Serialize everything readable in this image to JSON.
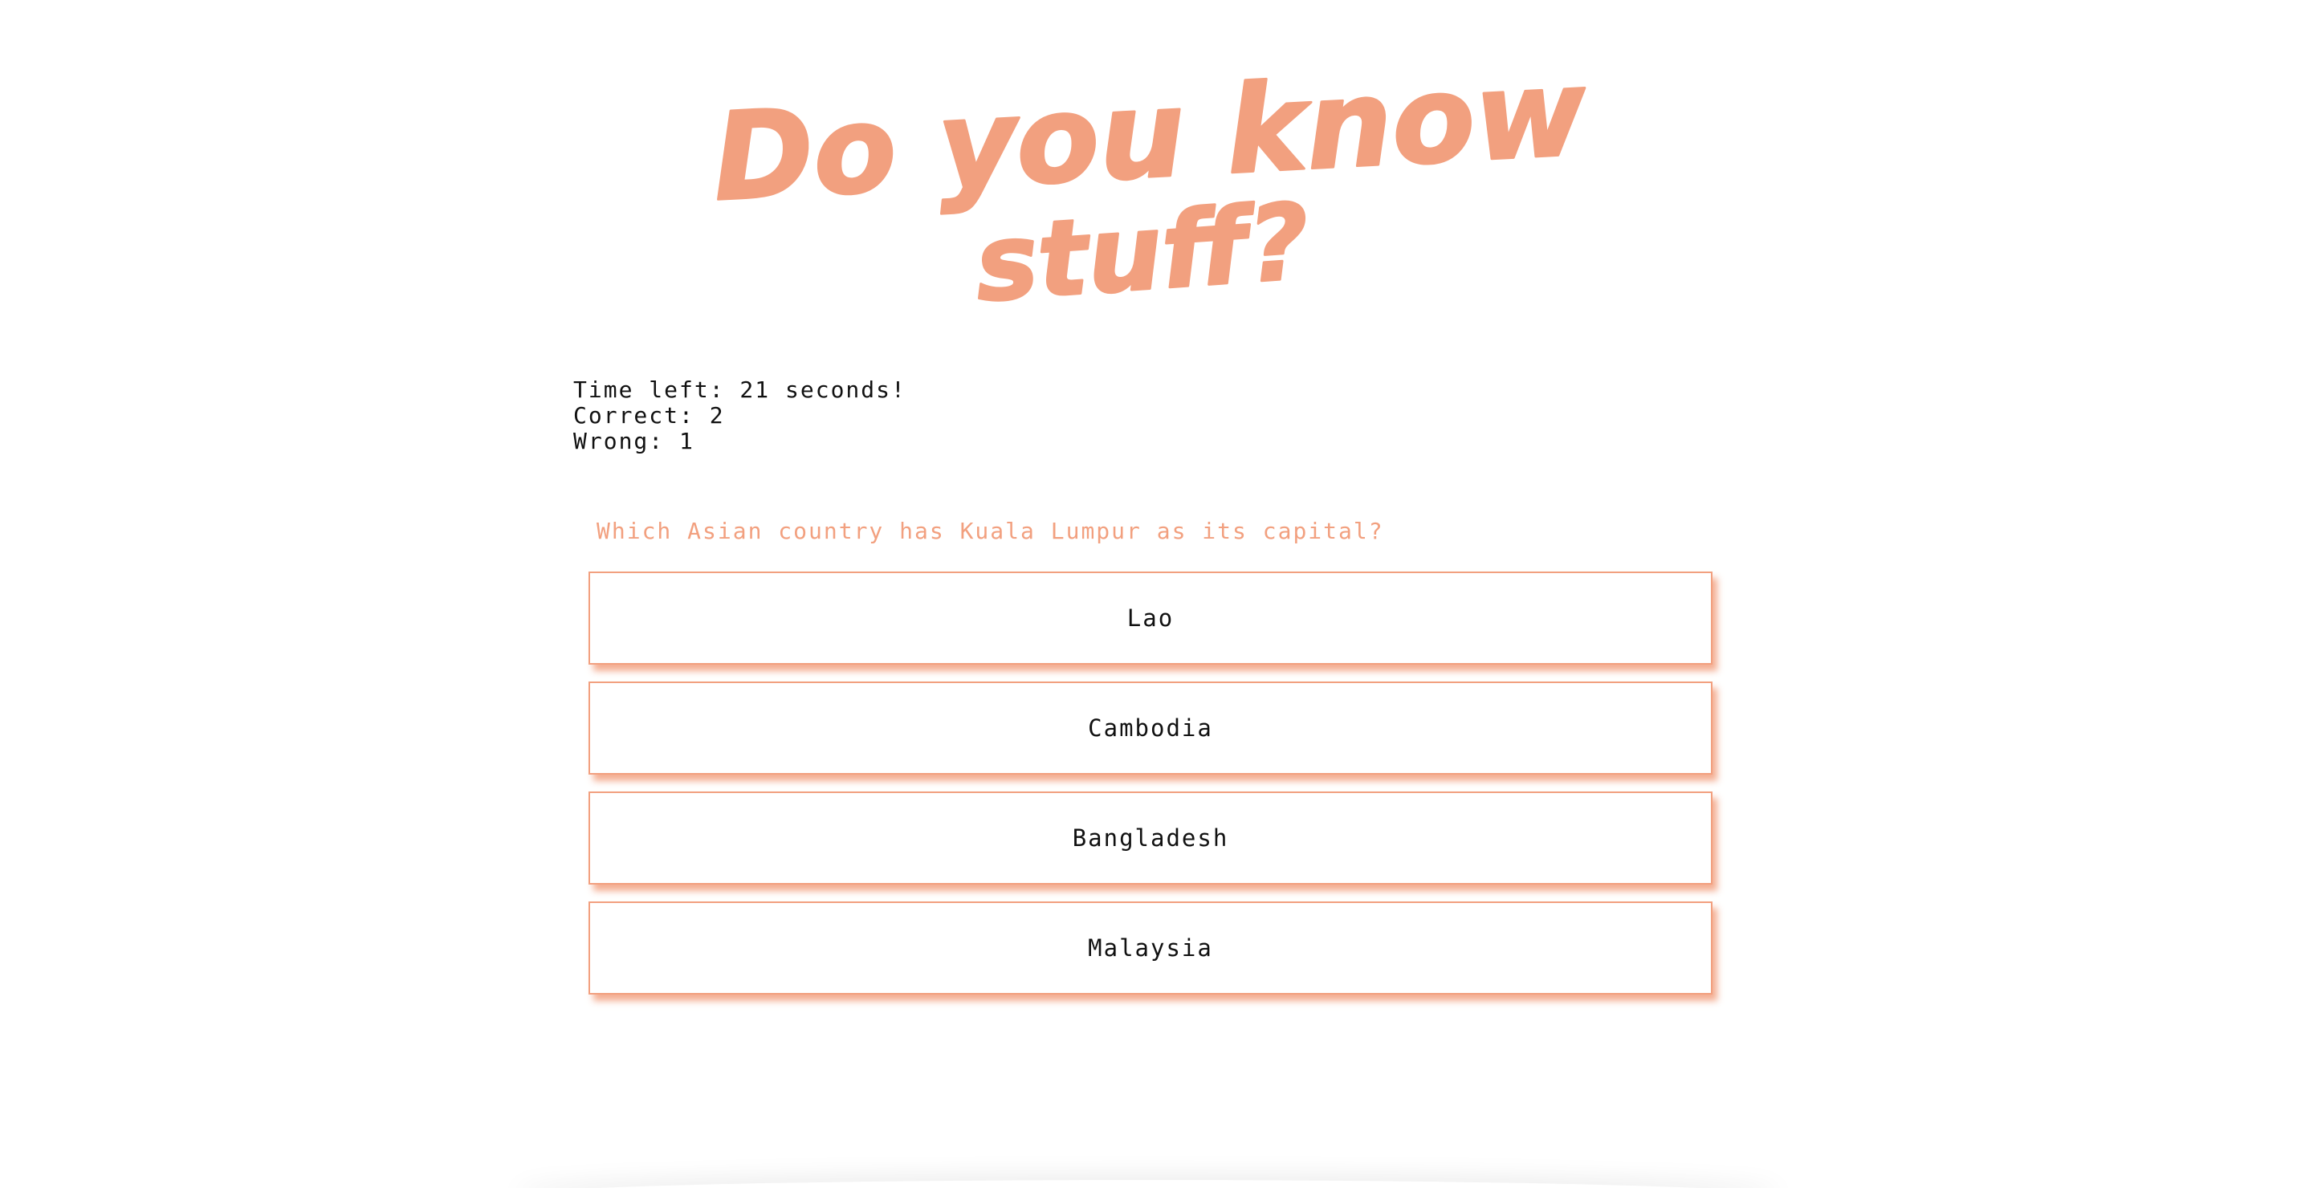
{
  "header": {
    "title_line1": "Do you know",
    "title_line2": "stuff?"
  },
  "stats": {
    "time_left": "Time left: 21 seconds!",
    "correct": "Correct: 2",
    "wrong": "Wrong: 1"
  },
  "quiz": {
    "question": "Which Asian country has Kuala Lumpur as its capital?",
    "answers": [
      {
        "label": "Lao"
      },
      {
        "label": "Cambodia"
      },
      {
        "label": "Bangladesh"
      },
      {
        "label": "Malaysia"
      }
    ]
  },
  "colors": {
    "accent": "#f2a07f",
    "text": "#111111",
    "background": "#ffffff"
  }
}
